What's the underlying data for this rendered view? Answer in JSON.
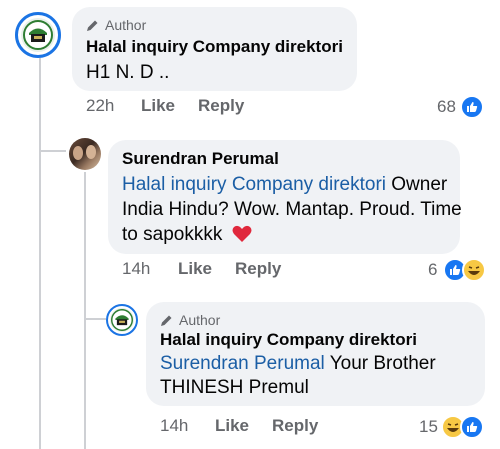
{
  "comments": [
    {
      "author_badge": "Author",
      "name": "Halal inquiry Company direktori",
      "text_lines": [
        "H1 N. D .."
      ],
      "time": "22h",
      "like_label": "Like",
      "reply_label": "Reply",
      "reaction_count": "68"
    },
    {
      "name": "Surendran Perumal",
      "mention": "Halal inquiry Company direktori",
      "text_line1_rest": "Owner",
      "text_line2": "India Hindu? Wow. Mantap. Proud. Time",
      "text_line3": "to sapokkkk",
      "time": "14h",
      "like_label": "Like",
      "reply_label": "Reply",
      "reaction_count": "6"
    },
    {
      "author_badge": "Author",
      "name": "Halal inquiry Company direktori",
      "mention": "Surendran Perumal",
      "text_line1_rest": "Your Brother",
      "text_line2": "THINESH Premul",
      "time": "14h",
      "like_label": "Like",
      "reply_label": "Reply",
      "reaction_count": "15"
    }
  ],
  "icons": [
    "pencil-icon",
    "like-reaction-icon",
    "haha-reaction-icon",
    "heart-emoji"
  ],
  "colors": {
    "mention": "#1b5ea5",
    "bubble": "#f0f2f5",
    "like_blue": "#1877f2",
    "ring_blue": "#1b74e4"
  }
}
